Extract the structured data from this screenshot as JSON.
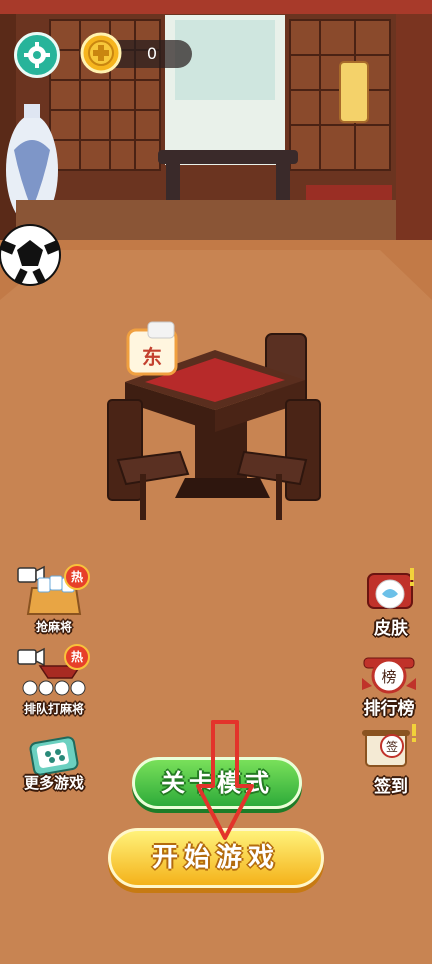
{
  "hud": {
    "coins": "0",
    "settings_icon": "gear-icon",
    "coin_icon": "coin-icon"
  },
  "left_menu": [
    {
      "label": "抢麻将",
      "badge": "热",
      "icon": "video-crate-icon"
    },
    {
      "label": "排队打麻将",
      "badge": "热",
      "icon": "video-queue-icon"
    },
    {
      "label": "更多游戏",
      "icon": "mahjong-tile-icon"
    }
  ],
  "right_menu": [
    {
      "label": "皮肤",
      "icon": "skin-gift-icon"
    },
    {
      "label": "排行榜",
      "icon": "ranking-icon",
      "emblem": "榜"
    },
    {
      "label": "签到",
      "icon": "checkin-scroll-icon",
      "emblem": "签"
    }
  ],
  "scene": {
    "tile_char": "东"
  },
  "buttons": {
    "level_mode": "关卡模式",
    "start_game": "开始游戏"
  },
  "colors": {
    "floor": "#c27a47",
    "green_button": "#3cbf42",
    "yellow_button": "#f7c52a",
    "settings_teal": "#27b49a",
    "hint_arrow": "#e3342b"
  }
}
